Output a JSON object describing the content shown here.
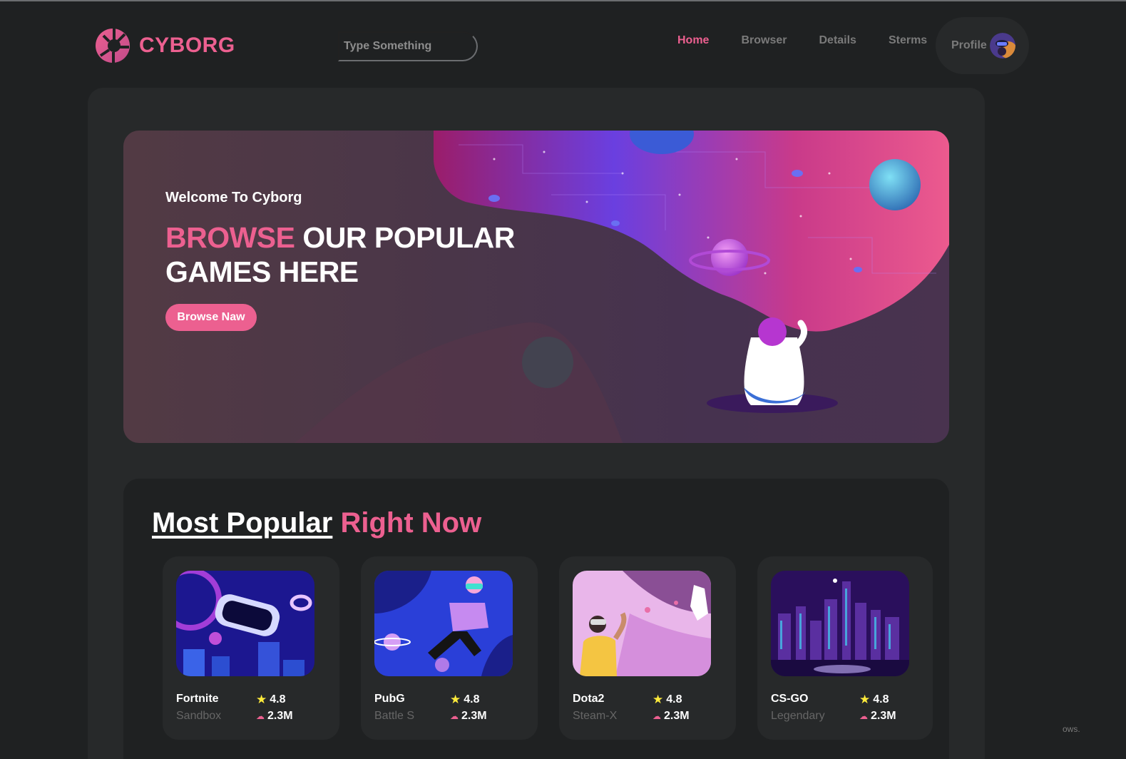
{
  "header": {
    "logo_text": "CYBORG",
    "search_placeholder": "Type Something",
    "nav": [
      {
        "label": "Home",
        "active": true
      },
      {
        "label": "Browser",
        "active": false
      },
      {
        "label": "Details",
        "active": false
      },
      {
        "label": "Sterms",
        "active": false
      }
    ],
    "profile_label": "Profile"
  },
  "banner": {
    "subtitle": "Welcome To Cyborg",
    "title_highlight": "BROWSE",
    "title_rest_line1": " OUR POPULAR",
    "title_line2": "GAMES HERE",
    "button_label": "Browse Naw"
  },
  "popular": {
    "heading_main": "Most Popular",
    "heading_accent": "Right Now",
    "games": [
      {
        "name": "Fortnite",
        "category": "Sandbox",
        "rating": "4.8",
        "downloads": "2.3M"
      },
      {
        "name": "PubG",
        "category": "Battle S",
        "rating": "4.8",
        "downloads": "2.3M"
      },
      {
        "name": "Dota2",
        "category": "Steam-X",
        "rating": "4.8",
        "downloads": "2.3M"
      },
      {
        "name": "CS-GO",
        "category": "Legendary",
        "rating": "4.8",
        "downloads": "2.3M"
      }
    ]
  },
  "corner_text": "ows.",
  "colors": {
    "accent": "#ec6090",
    "background": "#1f2122",
    "panel": "#27292a"
  }
}
